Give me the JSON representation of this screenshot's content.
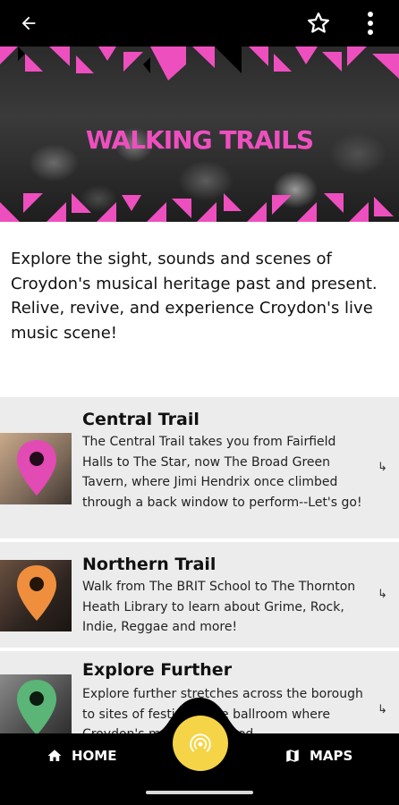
{
  "header": {
    "back_icon": "arrow-left-icon",
    "favorite_icon": "star-outline-icon",
    "more_icon": "more-vertical-icon"
  },
  "hero": {
    "title": "WALKING TRAILS",
    "accent_color": "#ee4fbf"
  },
  "intro": {
    "paragraph1": "Explore the sight, sounds and scenes of Croydon's musical heritage past and present.",
    "paragraph2": "Relive, revive, and experience Croydon's live music scene!"
  },
  "trails": [
    {
      "title": "Central Trail",
      "description": "The Central Trail takes you from Fairfield Halls to The Star, now The Broad Green Tavern, where Jimi Hendrix once climbed through a back window to perform--Let's go!",
      "pin_color": "#e24ab4"
    },
    {
      "title": "Northern Trail",
      "description": "Walk from The BRIT School to The Thornton Heath Library to learn about Grime, Rock, Indie, Reggae and more!",
      "pin_color": "#ef8f3d"
    },
    {
      "title": "Explore Further",
      "description": "Explore further stretches across the borough to sites of festivals, the ballroom where Croydon's music originated",
      "pin_color": "#5ab576"
    }
  ],
  "bottom_nav": {
    "home_label": "HOME",
    "maps_label": "MAPS",
    "fab_color": "#f5d547",
    "fab_icon": "broadcast-icon"
  }
}
